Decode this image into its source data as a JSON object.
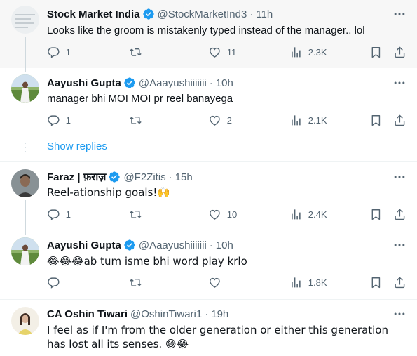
{
  "tweets": [
    {
      "name": "Stock Market India",
      "verified": true,
      "handle": "@StockMarketInd3",
      "time": "11h",
      "text": "Looks like the groom is mistakenly typed instead of the manager.. lol",
      "replies": "1",
      "retweets": "",
      "likes": "11",
      "views": "2.3K"
    },
    {
      "name": "Aayushi Gupta",
      "verified": true,
      "handle": "@Aaayushiiiiiii",
      "time": "10h",
      "text": "manager bhi MOI MOI pr reel banayega",
      "replies": "1",
      "retweets": "",
      "likes": "2",
      "views": "2.1K"
    },
    {
      "name": "Faraz | फ़राज़",
      "verified": true,
      "handle": "@F2Zitis",
      "time": "15h",
      "text": "Reel-ationship goals!🙌",
      "replies": "1",
      "retweets": "",
      "likes": "10",
      "views": "2.4K"
    },
    {
      "name": "Aayushi Gupta",
      "verified": true,
      "handle": "@Aaayushiiiiiii",
      "time": "10h",
      "text": "😂😂😂ab tum isme bhi word play krlo",
      "replies": "",
      "retweets": "",
      "likes": "",
      "views": "1.8K"
    },
    {
      "name": "CA Oshin Tiwari",
      "verified": false,
      "handle": "@OshinTiwari1",
      "time": "19h",
      "text": "I feel as if I'm from the older generation or either this generation has lost all its senses. 😅😂"
    }
  ],
  "show_replies": "Show replies",
  "separator": "·",
  "colors": {
    "accent": "#1d9bf0",
    "muted": "#536471",
    "highlight_bg": "#f7f7f7"
  },
  "icons": [
    "reply-icon",
    "retweet-icon",
    "like-icon",
    "views-icon",
    "bookmark-icon",
    "share-icon",
    "more-icon",
    "verified-badge-icon"
  ]
}
